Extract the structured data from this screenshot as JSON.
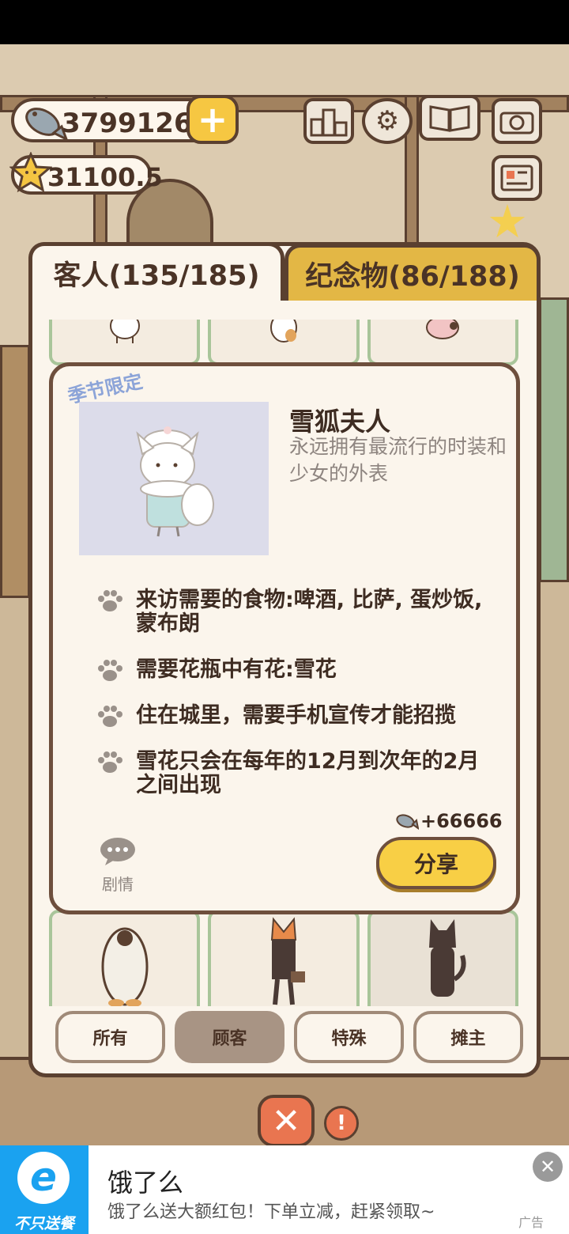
{
  "hud": {
    "fish_count": "3799126",
    "star_count": "31100.5",
    "plus_label": "+"
  },
  "tabs": {
    "guests": "客人(135/185)",
    "souvenirs": "纪念物(86/188)"
  },
  "detail": {
    "badge": "季节限定",
    "name": "雪狐夫人",
    "description": "永远拥有最流行的时装和少女的外表",
    "requirements": [
      "来访需要的食物:啤酒, 比萨, 蛋炒饭, 蒙布朗",
      "需要花瓶中有花:雪花",
      "住在城里，需要手机宣传才能招揽",
      "雪花只会在每年的12月到次年的2月之间出现"
    ],
    "reward": "+66666",
    "story_label": "剧情",
    "share_label": "分享"
  },
  "filters": [
    "所有",
    "顾客",
    "特殊",
    "摊主"
  ],
  "active_filter": "顾客",
  "close_label": "✕",
  "ad": {
    "logo_slogan": "不只送餐",
    "title": "饿了么",
    "description": "饿了么送大额红包！下单立减，赶紧领取~",
    "label": "广告",
    "close": "✕"
  },
  "colors": {
    "panel_bg": "#fbf5ec",
    "border_brown": "#5a4030",
    "tab_gold": "#e3b745",
    "share_yellow": "#f8cf45",
    "badge_blue": "#8ca4d8",
    "ad_blue": "#1aa2f0"
  }
}
